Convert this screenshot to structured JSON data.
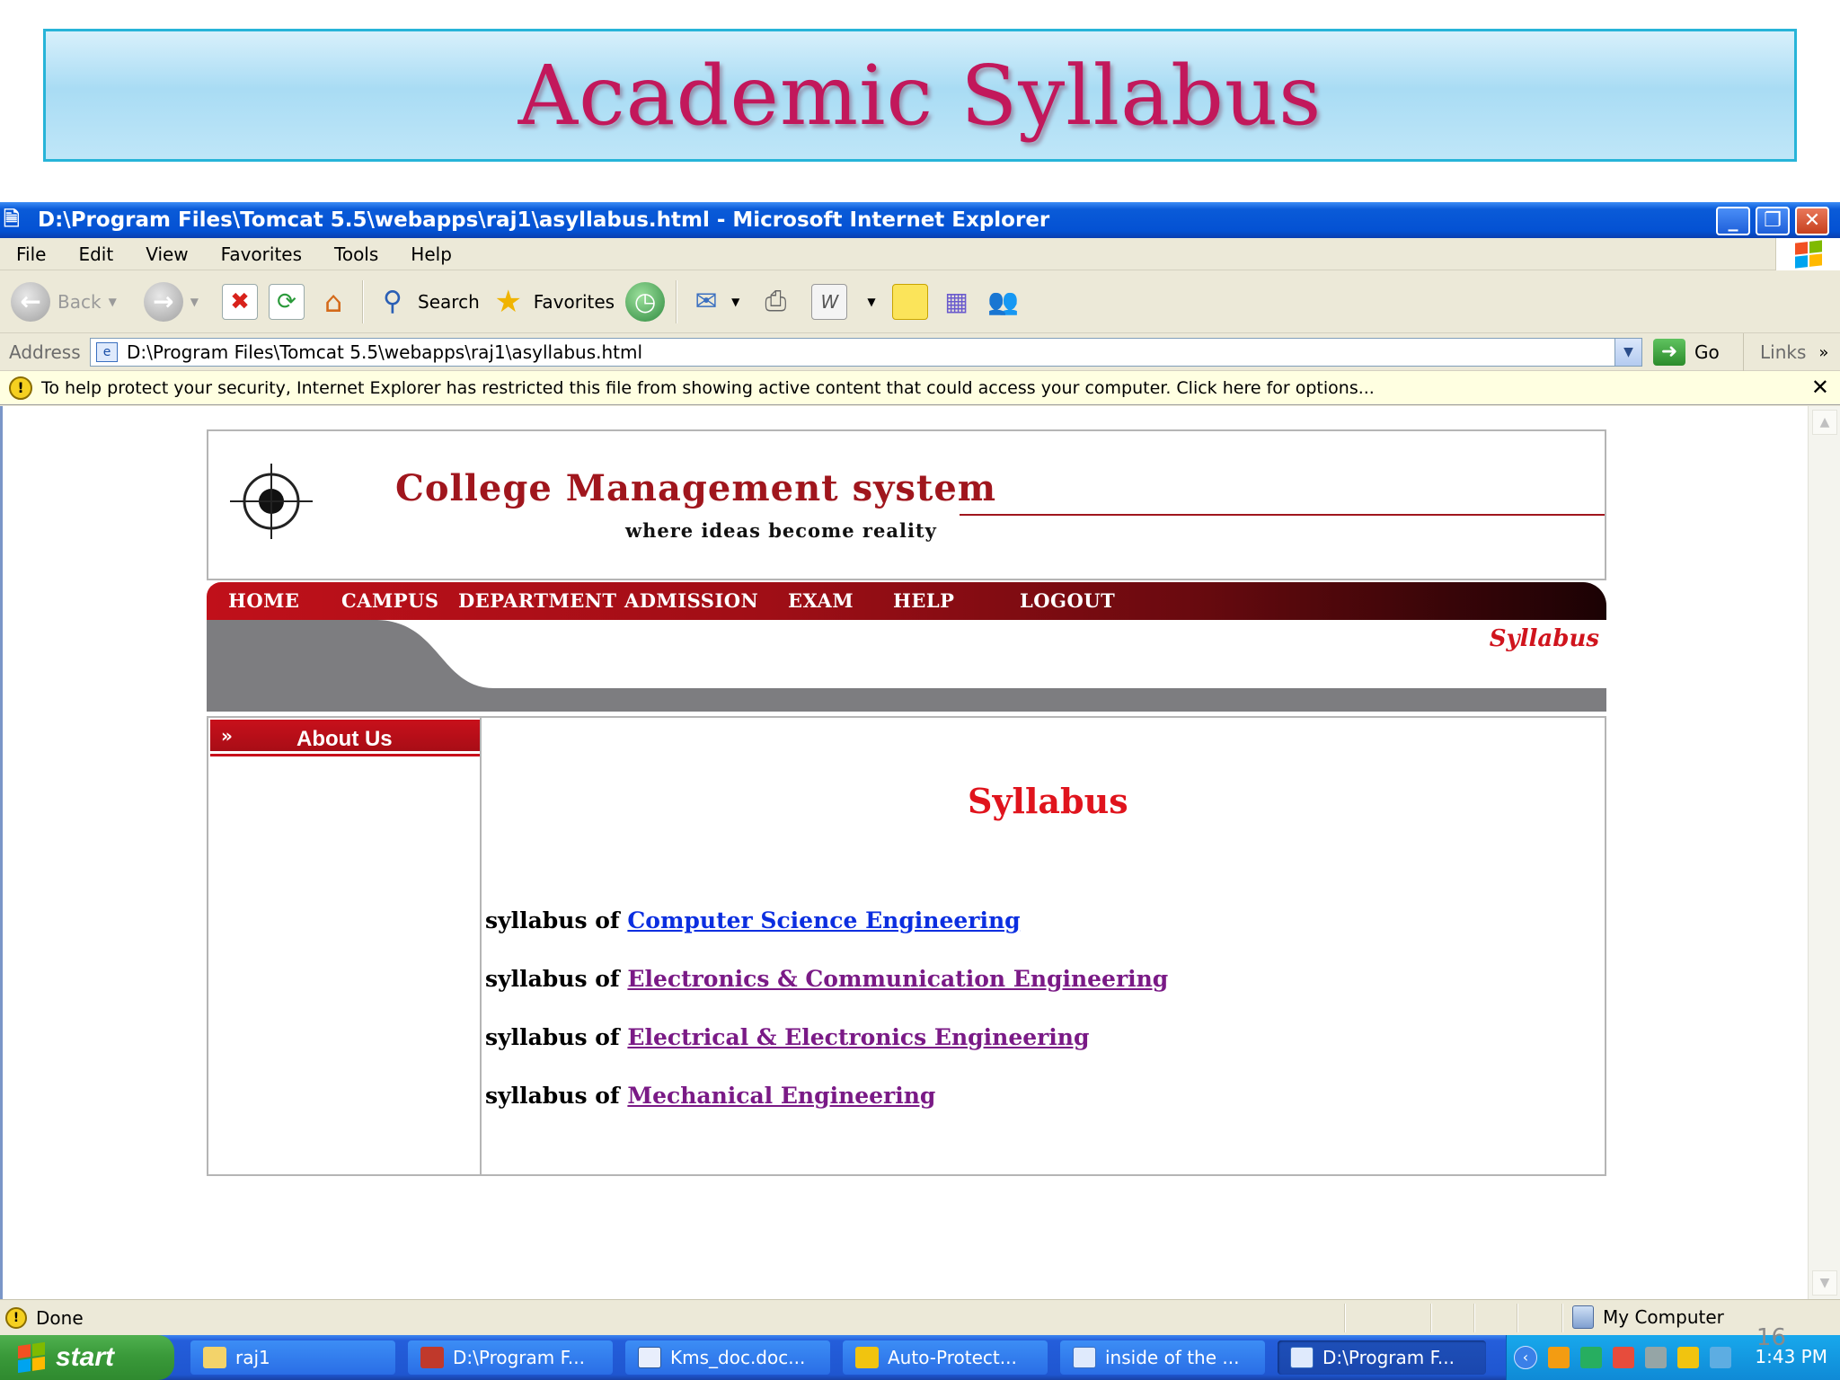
{
  "slide": {
    "banner_title": "Academic Syllabus",
    "slide_number": "16"
  },
  "window": {
    "title": "D:\\Program Files\\Tomcat 5.5\\webapps\\raj1\\asyllabus.html - Microsoft Internet Explorer"
  },
  "menu": {
    "items": [
      "File",
      "Edit",
      "View",
      "Favorites",
      "Tools",
      "Help"
    ]
  },
  "toolbar": {
    "back_label": "Back",
    "search_label": "Search",
    "favorites_label": "Favorites"
  },
  "address": {
    "label": "Address",
    "url": "D:\\Program Files\\Tomcat 5.5\\webapps\\raj1\\asyllabus.html",
    "go_label": "Go",
    "links_label": "Links"
  },
  "infobar": {
    "message": "To help protect your security, Internet Explorer has restricted this file from showing active content that could access your computer. Click here for options..."
  },
  "page": {
    "site_title": "College Management system",
    "tagline": "where ideas become reality",
    "nav": [
      "HOME",
      "CAMPUS",
      "DEPARTMENT",
      "ADMISSION",
      "EXAM",
      "HELP",
      "LOGOUT"
    ],
    "section_tag": "Syllabus",
    "sidebar_heading": "About Us",
    "main_heading": "Syllabus",
    "syllabus_prefix": "syllabus of",
    "syllabus_links": [
      "Computer Science Engineering",
      "Electronics & Communication Engineering",
      "Electrical & Electronics Engineering",
      "Mechanical Engineering"
    ],
    "colors": {
      "brand_red": "#a0161d",
      "heading_red": "#e0141d",
      "link_unvisited": "#0b2ee0",
      "link_visited": "#7a1a86"
    }
  },
  "status": {
    "text": "Done",
    "zone": "My Computer"
  },
  "taskbar": {
    "start_label": "start",
    "tasks": [
      "raj1",
      "D:\\Program F...",
      "Kms_doc.doc...",
      "Auto-Protect...",
      "inside of the ...",
      "D:\\Program F..."
    ],
    "clock": "1:43 PM"
  },
  "icons": {
    "title": "ie-page-icon",
    "back": "back-arrow-icon",
    "forward": "forward-arrow-icon",
    "stop": "stop-icon",
    "refresh": "refresh-icon",
    "home": "home-icon",
    "search": "search-icon",
    "favorites": "star-icon",
    "history": "history-icon",
    "mail": "mail-icon",
    "print": "printer-icon",
    "edit": "word-edit-icon"
  }
}
